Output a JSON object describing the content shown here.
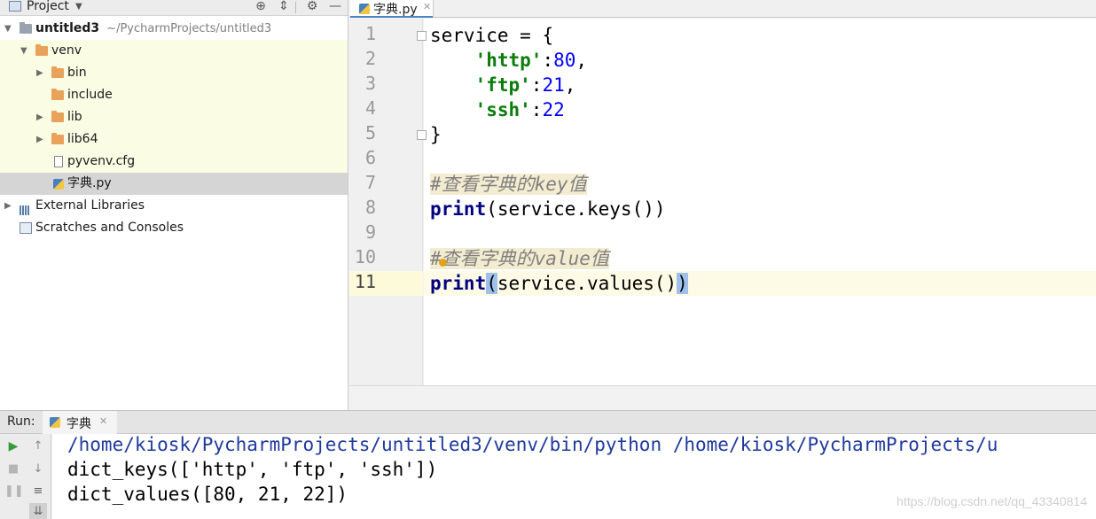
{
  "project_panel": {
    "title": "Project",
    "tree": [
      {
        "label": "untitled3",
        "sublabel": "~/PycharmProjects/untitled3",
        "icon": "folder-grey-icon"
      },
      {
        "label": "venv",
        "icon": "folder-icon"
      },
      {
        "label": "bin",
        "icon": "folder-icon"
      },
      {
        "label": "include",
        "icon": "folder-icon"
      },
      {
        "label": "lib",
        "icon": "folder-icon"
      },
      {
        "label": "lib64",
        "icon": "folder-link-icon"
      },
      {
        "label": "pyvenv.cfg",
        "icon": "config-file-icon"
      },
      {
        "label": "字典.py",
        "icon": "python-file-icon"
      },
      {
        "label": "External Libraries",
        "icon": "library-icon"
      },
      {
        "label": "Scratches and Consoles",
        "icon": "scratch-icon"
      }
    ]
  },
  "editor": {
    "tab_label": "字典.py",
    "line_numbers": [
      "1",
      "2",
      "3",
      "4",
      "5",
      "6",
      "7",
      "8",
      "9",
      "10",
      "11"
    ],
    "code": {
      "l1_var": "service",
      "l1_rest": " = {",
      "l2_indent": "    ",
      "l2_key": "'http'",
      "l2_colon": ":",
      "l2_val": "80",
      "l2_comma": ",",
      "l3_indent": "    ",
      "l3_key": "'ftp'",
      "l3_colon": ":",
      "l3_val": "21",
      "l3_comma": ",",
      "l4_indent": "    ",
      "l4_key": "'ssh'",
      "l4_colon": ":",
      "l4_val": "22",
      "l5": "}",
      "l7_comment": "#查看字典的key值",
      "l8_kw": "print",
      "l8_rest": "(service.keys())",
      "l10_comment": "#查看字典的value值",
      "l11_kw": "print",
      "l11_open": "(",
      "l11_mid": "service.values()",
      "l11_close": ")"
    }
  },
  "run_panel": {
    "title": "Run:",
    "tab_label": "字典",
    "console": [
      "/home/kiosk/PycharmProjects/untitled3/venv/bin/python /home/kiosk/PycharmProjects/u",
      "dict_keys(['http', 'ftp', 'ssh'])",
      "dict_values([80, 21, 22])"
    ],
    "watermark": "https://blog.csdn.net/qq_43340814"
  },
  "colors": {
    "keyword": "#00007f",
    "string": "#0a7d0a",
    "number": "#0000ff",
    "comment_bg": "#f4ecd0",
    "selection": "#d5d5d5"
  }
}
